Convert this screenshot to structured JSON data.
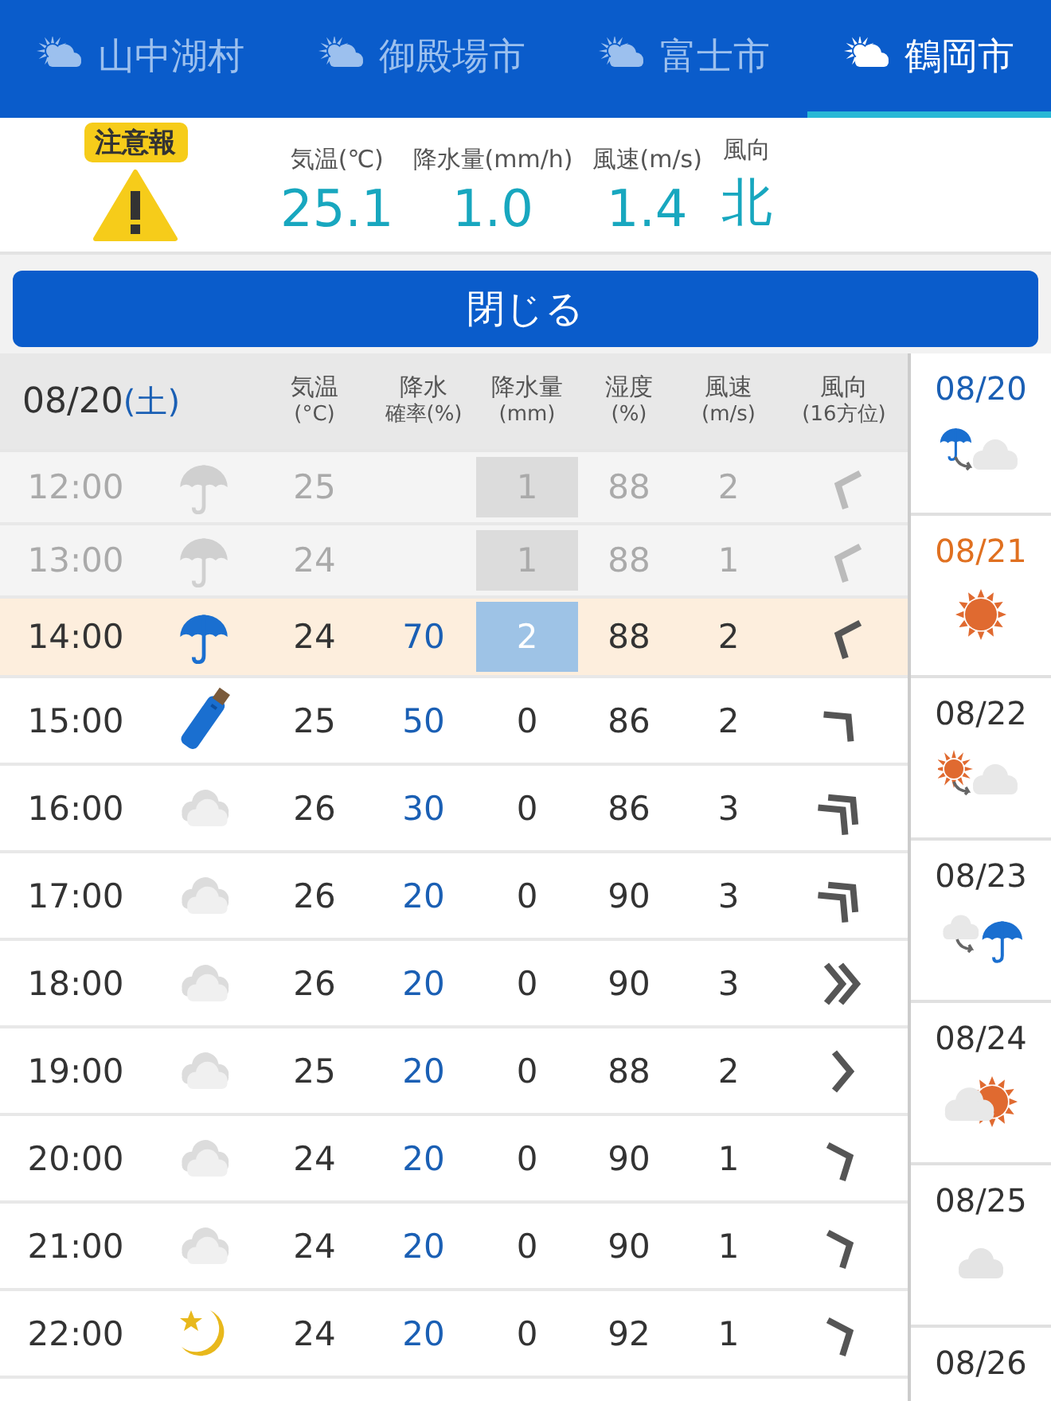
{
  "tabs": [
    {
      "label": "山中湖村",
      "selected": false
    },
    {
      "label": "御殿場市",
      "selected": false
    },
    {
      "label": "富士市",
      "selected": false
    },
    {
      "label": "鶴岡市",
      "selected": true
    }
  ],
  "current": {
    "warning": "注意報",
    "readings": [
      {
        "label": "気温(℃)",
        "value": "25.1"
      },
      {
        "label": "降水量(mm/h)",
        "value": "1.0"
      },
      {
        "label": "風速(m/s)",
        "value": "1.4"
      },
      {
        "label": "風向",
        "value": "北"
      }
    ]
  },
  "close_button": "閉じる",
  "table": {
    "date": "08/20",
    "weekday": {
      "text": "(土)",
      "color": "#1a5fb4"
    },
    "columns": [
      {
        "line1": "気温",
        "line2": "(°C)"
      },
      {
        "line1": "降水",
        "line2": "確率(%)"
      },
      {
        "line1": "降水量",
        "line2": "(mm)"
      },
      {
        "line1": "湿度",
        "line2": "(%)"
      },
      {
        "line1": "風速",
        "line2": "(m/s)"
      },
      {
        "line1": "風向",
        "line2": "(16方位)"
      }
    ],
    "rows": [
      {
        "time": "12:00",
        "past": true,
        "current": false,
        "weather": {
          "kind": "umbrella"
        },
        "temp": "25",
        "amount": "1",
        "rain_box": true,
        "humidity": "88",
        "speed": "2",
        "wind": {
          "kind": "wnw",
          "double": false
        }
      },
      {
        "time": "13:00",
        "past": true,
        "current": false,
        "weather": {
          "kind": "umbrella"
        },
        "temp": "24",
        "amount": "1",
        "rain_box": true,
        "humidity": "88",
        "speed": "1",
        "wind": {
          "kind": "wnw",
          "double": false
        }
      },
      {
        "time": "14:00",
        "past": false,
        "current": true,
        "weather": {
          "kind": "umbrella"
        },
        "temp": "24",
        "probability": "70",
        "amount": "2",
        "rain_box": true,
        "humidity": "88",
        "speed": "2",
        "wind": {
          "kind": "wnw",
          "double": false
        }
      },
      {
        "time": "15:00",
        "past": false,
        "current": false,
        "weather": {
          "kind": "closed-umbrella"
        },
        "temp": "25",
        "probability": "50",
        "amount": "0",
        "rain_box": false,
        "humidity": "86",
        "speed": "2",
        "wind": {
          "kind": "ne",
          "double": false
        }
      },
      {
        "time": "16:00",
        "past": false,
        "current": false,
        "weather": {
          "kind": "cloud"
        },
        "temp": "26",
        "probability": "30",
        "amount": "0",
        "rain_box": false,
        "humidity": "86",
        "speed": "3",
        "wind": {
          "kind": "ne",
          "double": true
        }
      },
      {
        "time": "17:00",
        "past": false,
        "current": false,
        "weather": {
          "kind": "cloud"
        },
        "temp": "26",
        "probability": "20",
        "amount": "0",
        "rain_box": false,
        "humidity": "90",
        "speed": "3",
        "wind": {
          "kind": "ne",
          "double": true
        }
      },
      {
        "time": "18:00",
        "past": false,
        "current": false,
        "weather": {
          "kind": "cloud"
        },
        "temp": "26",
        "probability": "20",
        "amount": "0",
        "rain_box": false,
        "humidity": "90",
        "speed": "3",
        "wind": {
          "kind": "e",
          "double": true
        }
      },
      {
        "time": "19:00",
        "past": false,
        "current": false,
        "weather": {
          "kind": "cloud"
        },
        "temp": "25",
        "probability": "20",
        "amount": "0",
        "rain_box": false,
        "humidity": "88",
        "speed": "2",
        "wind": {
          "kind": "e",
          "double": false
        }
      },
      {
        "time": "20:00",
        "past": false,
        "current": false,
        "weather": {
          "kind": "cloud"
        },
        "temp": "24",
        "probability": "20",
        "amount": "0",
        "rain_box": false,
        "humidity": "90",
        "speed": "1",
        "wind": {
          "kind": "ene",
          "double": false
        }
      },
      {
        "time": "21:00",
        "past": false,
        "current": false,
        "weather": {
          "kind": "cloud"
        },
        "temp": "24",
        "probability": "20",
        "amount": "0",
        "rain_box": false,
        "humidity": "90",
        "speed": "1",
        "wind": {
          "kind": "ene",
          "double": false
        }
      },
      {
        "time": "22:00",
        "past": false,
        "current": false,
        "weather": {
          "kind": "moon"
        },
        "temp": "24",
        "probability": "20",
        "amount": "0",
        "rain_box": false,
        "humidity": "92",
        "speed": "1",
        "wind": {
          "kind": "ene",
          "double": false
        }
      }
    ]
  },
  "days": [
    {
      "date": "08/20",
      "color": "#1a5fb4",
      "weather": {
        "kind": "rain-to-cloud"
      }
    },
    {
      "date": "08/21",
      "color": "#e07020",
      "weather": {
        "kind": "sun"
      }
    },
    {
      "date": "08/22",
      "color": "#333333",
      "weather": {
        "kind": "sun-to-cloud"
      }
    },
    {
      "date": "08/23",
      "color": "#333333",
      "weather": {
        "kind": "cloud-to-rain"
      }
    },
    {
      "date": "08/24",
      "color": "#333333",
      "weather": {
        "kind": "cloud-sun"
      }
    },
    {
      "date": "08/25",
      "color": "#333333",
      "weather": {
        "kind": "cloud"
      }
    },
    {
      "date": "08/26",
      "color": "#333333"
    }
  ]
}
